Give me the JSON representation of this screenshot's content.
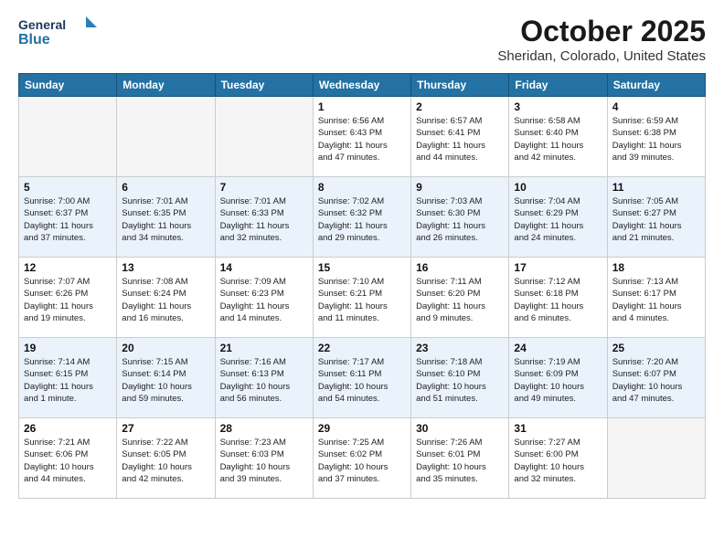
{
  "header": {
    "logo_line1": "General",
    "logo_line2": "Blue",
    "title": "October 2025",
    "subtitle": "Sheridan, Colorado, United States"
  },
  "days_of_week": [
    "Sunday",
    "Monday",
    "Tuesday",
    "Wednesday",
    "Thursday",
    "Friday",
    "Saturday"
  ],
  "weeks": [
    [
      {
        "day": "",
        "info": ""
      },
      {
        "day": "",
        "info": ""
      },
      {
        "day": "",
        "info": ""
      },
      {
        "day": "1",
        "info": "Sunrise: 6:56 AM\nSunset: 6:43 PM\nDaylight: 11 hours\nand 47 minutes."
      },
      {
        "day": "2",
        "info": "Sunrise: 6:57 AM\nSunset: 6:41 PM\nDaylight: 11 hours\nand 44 minutes."
      },
      {
        "day": "3",
        "info": "Sunrise: 6:58 AM\nSunset: 6:40 PM\nDaylight: 11 hours\nand 42 minutes."
      },
      {
        "day": "4",
        "info": "Sunrise: 6:59 AM\nSunset: 6:38 PM\nDaylight: 11 hours\nand 39 minutes."
      }
    ],
    [
      {
        "day": "5",
        "info": "Sunrise: 7:00 AM\nSunset: 6:37 PM\nDaylight: 11 hours\nand 37 minutes."
      },
      {
        "day": "6",
        "info": "Sunrise: 7:01 AM\nSunset: 6:35 PM\nDaylight: 11 hours\nand 34 minutes."
      },
      {
        "day": "7",
        "info": "Sunrise: 7:01 AM\nSunset: 6:33 PM\nDaylight: 11 hours\nand 32 minutes."
      },
      {
        "day": "8",
        "info": "Sunrise: 7:02 AM\nSunset: 6:32 PM\nDaylight: 11 hours\nand 29 minutes."
      },
      {
        "day": "9",
        "info": "Sunrise: 7:03 AM\nSunset: 6:30 PM\nDaylight: 11 hours\nand 26 minutes."
      },
      {
        "day": "10",
        "info": "Sunrise: 7:04 AM\nSunset: 6:29 PM\nDaylight: 11 hours\nand 24 minutes."
      },
      {
        "day": "11",
        "info": "Sunrise: 7:05 AM\nSunset: 6:27 PM\nDaylight: 11 hours\nand 21 minutes."
      }
    ],
    [
      {
        "day": "12",
        "info": "Sunrise: 7:07 AM\nSunset: 6:26 PM\nDaylight: 11 hours\nand 19 minutes."
      },
      {
        "day": "13",
        "info": "Sunrise: 7:08 AM\nSunset: 6:24 PM\nDaylight: 11 hours\nand 16 minutes."
      },
      {
        "day": "14",
        "info": "Sunrise: 7:09 AM\nSunset: 6:23 PM\nDaylight: 11 hours\nand 14 minutes."
      },
      {
        "day": "15",
        "info": "Sunrise: 7:10 AM\nSunset: 6:21 PM\nDaylight: 11 hours\nand 11 minutes."
      },
      {
        "day": "16",
        "info": "Sunrise: 7:11 AM\nSunset: 6:20 PM\nDaylight: 11 hours\nand 9 minutes."
      },
      {
        "day": "17",
        "info": "Sunrise: 7:12 AM\nSunset: 6:18 PM\nDaylight: 11 hours\nand 6 minutes."
      },
      {
        "day": "18",
        "info": "Sunrise: 7:13 AM\nSunset: 6:17 PM\nDaylight: 11 hours\nand 4 minutes."
      }
    ],
    [
      {
        "day": "19",
        "info": "Sunrise: 7:14 AM\nSunset: 6:15 PM\nDaylight: 11 hours\nand 1 minute."
      },
      {
        "day": "20",
        "info": "Sunrise: 7:15 AM\nSunset: 6:14 PM\nDaylight: 10 hours\nand 59 minutes."
      },
      {
        "day": "21",
        "info": "Sunrise: 7:16 AM\nSunset: 6:13 PM\nDaylight: 10 hours\nand 56 minutes."
      },
      {
        "day": "22",
        "info": "Sunrise: 7:17 AM\nSunset: 6:11 PM\nDaylight: 10 hours\nand 54 minutes."
      },
      {
        "day": "23",
        "info": "Sunrise: 7:18 AM\nSunset: 6:10 PM\nDaylight: 10 hours\nand 51 minutes."
      },
      {
        "day": "24",
        "info": "Sunrise: 7:19 AM\nSunset: 6:09 PM\nDaylight: 10 hours\nand 49 minutes."
      },
      {
        "day": "25",
        "info": "Sunrise: 7:20 AM\nSunset: 6:07 PM\nDaylight: 10 hours\nand 47 minutes."
      }
    ],
    [
      {
        "day": "26",
        "info": "Sunrise: 7:21 AM\nSunset: 6:06 PM\nDaylight: 10 hours\nand 44 minutes."
      },
      {
        "day": "27",
        "info": "Sunrise: 7:22 AM\nSunset: 6:05 PM\nDaylight: 10 hours\nand 42 minutes."
      },
      {
        "day": "28",
        "info": "Sunrise: 7:23 AM\nSunset: 6:03 PM\nDaylight: 10 hours\nand 39 minutes."
      },
      {
        "day": "29",
        "info": "Sunrise: 7:25 AM\nSunset: 6:02 PM\nDaylight: 10 hours\nand 37 minutes."
      },
      {
        "day": "30",
        "info": "Sunrise: 7:26 AM\nSunset: 6:01 PM\nDaylight: 10 hours\nand 35 minutes."
      },
      {
        "day": "31",
        "info": "Sunrise: 7:27 AM\nSunset: 6:00 PM\nDaylight: 10 hours\nand 32 minutes."
      },
      {
        "day": "",
        "info": ""
      }
    ]
  ]
}
